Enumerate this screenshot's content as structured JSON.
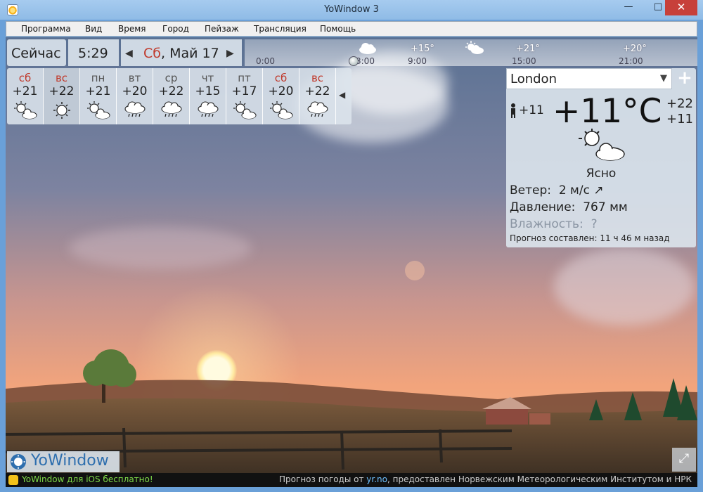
{
  "window": {
    "title": "YoWindow 3",
    "min_label": "—",
    "max_label": "□",
    "close_label": "✕"
  },
  "menu": [
    "Программа",
    "Вид",
    "Время",
    "Город",
    "Пейзаж",
    "Трансляция",
    "Помощь"
  ],
  "now_bar": {
    "now_label": "Сейчас",
    "time": "5:29",
    "weekday": "Сб",
    "date_rest": ", Май 17",
    "prev_icon": "◀",
    "next_icon": "▶"
  },
  "timeline": {
    "hours": [
      "0:00",
      "3:00",
      "9:00",
      "15:00",
      "21:00"
    ],
    "temps": [
      "+15°",
      "+21°",
      "+20°"
    ]
  },
  "forecast": {
    "collapse_icon": "◀",
    "days": [
      {
        "name": "сб",
        "temp": "+21",
        "weekend": true,
        "icon": "partly-cloudy-icon"
      },
      {
        "name": "вс",
        "temp": "+22",
        "weekend": true,
        "icon": "sun-icon",
        "selected": true
      },
      {
        "name": "пн",
        "temp": "+21",
        "weekend": false,
        "icon": "partly-cloudy-icon"
      },
      {
        "name": "вт",
        "temp": "+20",
        "weekend": false,
        "icon": "rain-icon"
      },
      {
        "name": "ср",
        "temp": "+22",
        "weekend": false,
        "icon": "rain-icon"
      },
      {
        "name": "чт",
        "temp": "+15",
        "weekend": false,
        "icon": "rain-icon"
      },
      {
        "name": "пт",
        "temp": "+17",
        "weekend": false,
        "icon": "partly-cloudy-icon"
      },
      {
        "name": "сб",
        "temp": "+20",
        "weekend": true,
        "icon": "partly-cloudy-icon"
      },
      {
        "name": "вс",
        "temp": "+22",
        "weekend": true,
        "icon": "rain-icon"
      }
    ]
  },
  "current": {
    "city": "London",
    "dropdown_icon": "▼",
    "add_icon": "+",
    "feels_icon": "person-icon",
    "feels_like": "+11",
    "temperature": "+11°C",
    "high": "+22",
    "low": "+11",
    "condition": "Ясно",
    "condition_icon": "partly-cloudy-icon",
    "wind_label": "Ветер:",
    "wind_value": "2 м/с ↗",
    "pressure_label": "Давление:",
    "pressure_value": "767 мм",
    "humidity_label": "Влажность:",
    "humidity_value": "?",
    "forecast_note": "Прогноз составлен:  11 ч 46 м назад"
  },
  "logo": {
    "text": "YoWindow"
  },
  "fullscreen_icon": "⤢",
  "status": {
    "left": "YoWindow для iOS бесплатно!",
    "right_prefix": "Прогноз погоды от ",
    "right_link": "yr.no",
    "right_suffix": ", предоставлен Норвежским Метеорологическим Институтом и НРК"
  },
  "colors": {
    "weekend": "#c0392b",
    "status_green": "#7fdc4a",
    "link": "#6fc0ff",
    "close_red": "#c7403a"
  }
}
